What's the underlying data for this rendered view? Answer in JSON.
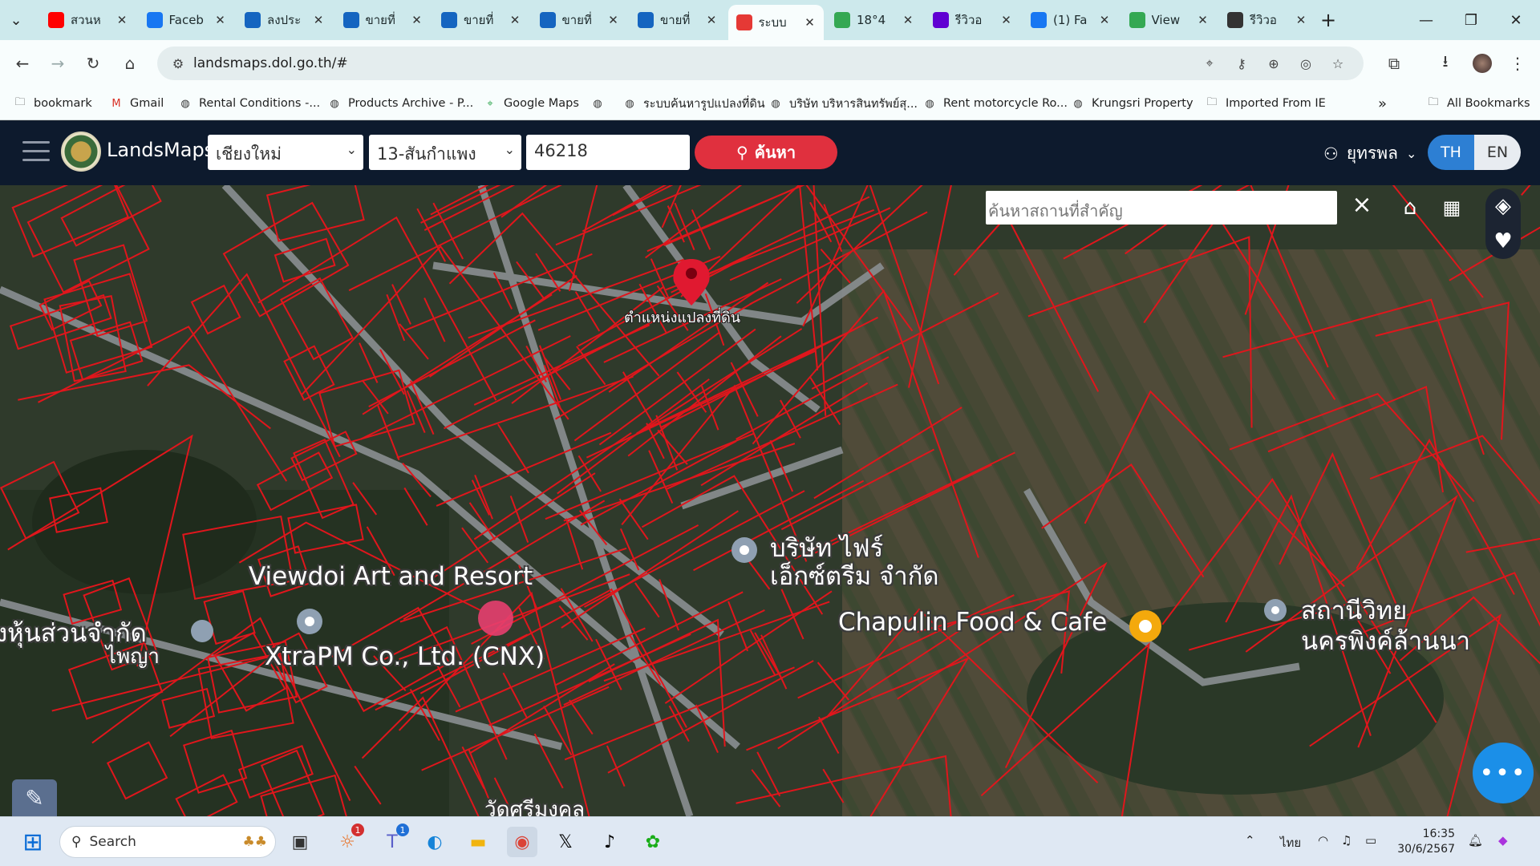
{
  "tabs": [
    {
      "label": "สวนห",
      "icon": "youtube-icon",
      "color": "#ff0000"
    },
    {
      "label": "Faceb",
      "icon": "facebook-icon",
      "color": "#1877f2"
    },
    {
      "label": "ลงประ",
      "icon": "house-icon",
      "color": "#1565c0"
    },
    {
      "label": "ขายที่",
      "icon": "house-icon",
      "color": "#1565c0"
    },
    {
      "label": "ขายที่",
      "icon": "house-icon",
      "color": "#1565c0"
    },
    {
      "label": "ขายที่",
      "icon": "house-icon",
      "color": "#1565c0"
    },
    {
      "label": "ขายที่",
      "icon": "house-icon",
      "color": "#1565c0"
    },
    {
      "label": "ระบบ",
      "icon": "map-pin-icon",
      "color": "#e53935",
      "active": true
    },
    {
      "label": "18°4",
      "icon": "google-maps-icon",
      "color": "#34a853"
    },
    {
      "label": "รีวิวอ",
      "icon": "yahoo-icon",
      "color": "#6001d2"
    },
    {
      "label": "(1) Fa",
      "icon": "facebook-icon",
      "color": "#1877f2"
    },
    {
      "label": "View",
      "icon": "google-maps-icon",
      "color": "#34a853"
    },
    {
      "label": "รีวิวอ",
      "icon": "review-icon",
      "color": "#333333"
    }
  ],
  "toolbar": {
    "url": "landsmaps.dol.go.th/#"
  },
  "bookmarks": [
    {
      "label": "bookmark",
      "icon": "folder-icon"
    },
    {
      "label": "Gmail",
      "icon": "gmail-icon"
    },
    {
      "label": "Rental Conditions -...",
      "icon": "globe-icon"
    },
    {
      "label": "Products Archive - P...",
      "icon": "globe-icon"
    },
    {
      "label": "Google Maps",
      "icon": "google-maps-icon"
    },
    {
      "label": "",
      "icon": "globe-icon"
    },
    {
      "label": "ระบบค้นหารูปแปลงที่ดิน",
      "icon": "globe-icon"
    },
    {
      "label": "บริษัท บริหารสินทรัพย์สุ...",
      "icon": "sam-icon"
    },
    {
      "label": "Rent motorcycle Ro...",
      "icon": "motorcycle-icon"
    },
    {
      "label": "Krungsri Property",
      "icon": "krungsri-icon"
    },
    {
      "label": "Imported From IE",
      "icon": "folder-icon"
    }
  ],
  "all_bookmarks": "All Bookmarks",
  "app": {
    "brand": "LandsMaps",
    "province": "เชียงใหม่",
    "district": "13-สันกำแพง",
    "parcel_no": "46218",
    "search_label": "ค้นหา",
    "user": "ยุทรพล",
    "lang_th": "TH",
    "lang_en": "EN"
  },
  "map": {
    "place_search_placeholder": "ค้นหาสถานที่สำคัญ",
    "parcel_marker_label": "ตำแหน่งแปลงที่ดิน",
    "labels": [
      "Viewdoi Art and Resort",
      "XtraPM Co., Ltd. (CNX)",
      "บริษัท ไฟร์",
      "เอ็กซ์ตรีม จำกัด",
      "Chapulin Food & Cafe",
      "สถานีวิทย",
      "นครพิงค์ล้านนา",
      "งหุ้นส่วนจำกัด",
      "ไพญา",
      "วัดศรีมงคล"
    ],
    "parcel_color": "#e0161c"
  },
  "taskbar": {
    "search_label": "Search",
    "lang": "ไทย",
    "time": "16:35",
    "date": "30/6/2567",
    "badges": [
      "1",
      "1"
    ]
  }
}
